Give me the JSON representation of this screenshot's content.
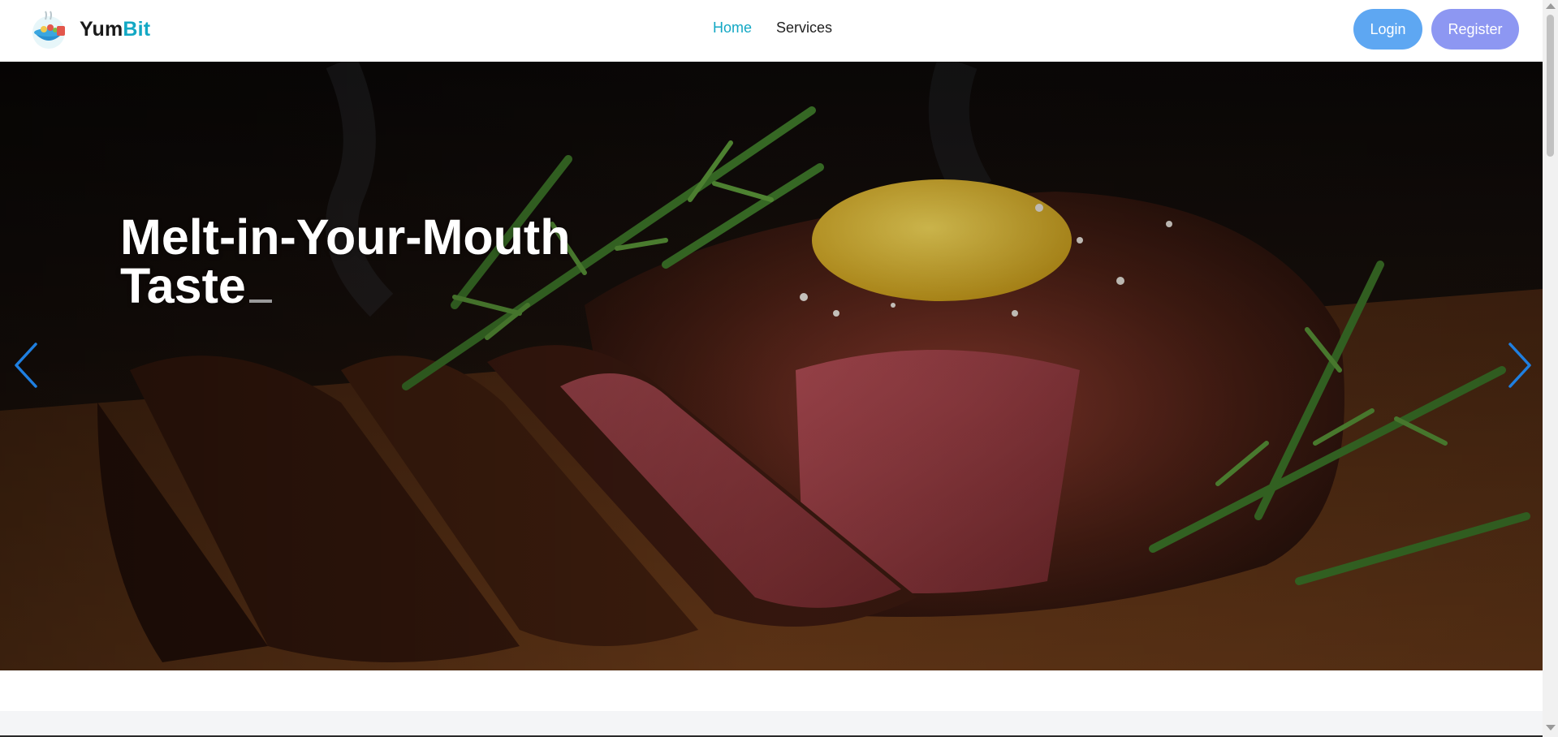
{
  "brand": {
    "name_part1": "Yum",
    "name_part2": "Bit"
  },
  "nav": {
    "links": [
      {
        "label": "Home",
        "active": true
      },
      {
        "label": "Services",
        "active": false
      }
    ],
    "login_label": "Login",
    "register_label": "Register"
  },
  "hero": {
    "title": "Melt-in-Your-Mouth Taste",
    "prev_icon": "chevron-left-icon",
    "next_icon": "chevron-right-icon"
  },
  "colors": {
    "accent": "#13a8c4",
    "login_button": "#5ea7f2",
    "register_button": "#8d97f2",
    "carousel_arrow": "#1f7fe0"
  }
}
